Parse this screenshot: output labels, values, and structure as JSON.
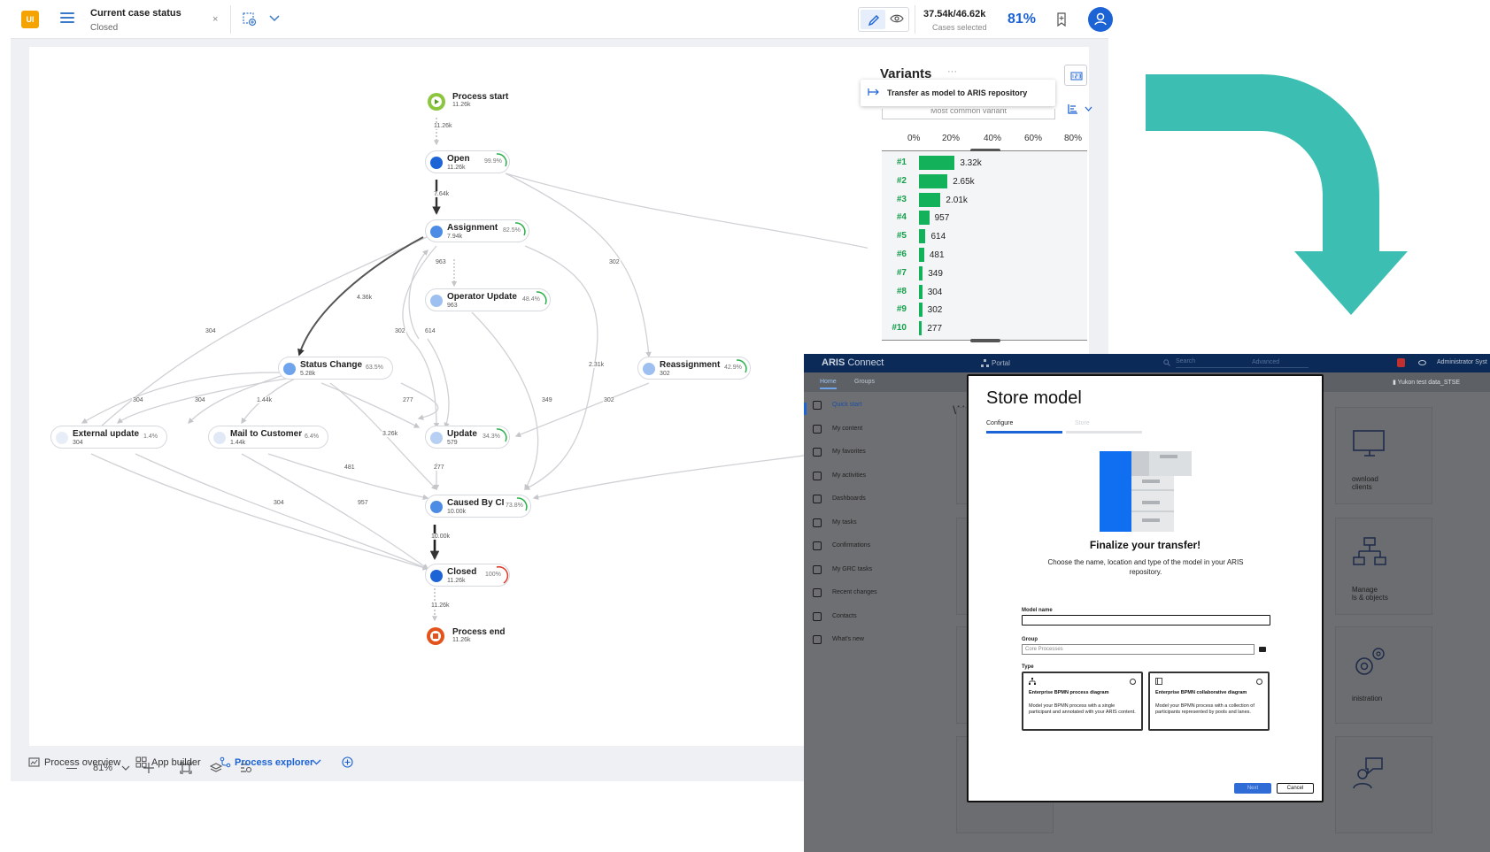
{
  "topbar": {
    "logo": "UI",
    "filter_title": "Current case status",
    "filter_value": "Closed",
    "filter_close": "×",
    "cases_count": "37.54k/46.62k",
    "cases_label": "Cases selected",
    "cases_pct": "81%"
  },
  "graph": {
    "start": {
      "label": "Process start",
      "count": "11.26k"
    },
    "end": {
      "label": "Process end",
      "count": "11.26k"
    },
    "nodes": {
      "open": {
        "label": "Open",
        "count": "11.26k",
        "pct": "99.9%"
      },
      "assignment": {
        "label": "Assignment",
        "count": "7.94k",
        "pct": "82.5%"
      },
      "operator_update": {
        "label": "Operator Update",
        "count": "963",
        "pct": "48.4%"
      },
      "status_change": {
        "label": "Status Change",
        "count": "5.28k",
        "pct": "63.5%"
      },
      "reassignment": {
        "label": "Reassignment",
        "count": "302",
        "pct": "42.9%"
      },
      "external_update": {
        "label": "External update",
        "count": "304",
        "pct": "1.4%"
      },
      "mail_to_customer": {
        "label": "Mail to Customer",
        "count": "1.44k",
        "pct": "6.4%"
      },
      "update": {
        "label": "Update",
        "count": "579",
        "pct": "34.3%"
      },
      "caused_by_ci": {
        "label": "Caused By CI",
        "count": "10.00k",
        "pct": "73.8%"
      },
      "closed": {
        "label": "Closed",
        "count": "11.26k",
        "pct": "100%"
      }
    },
    "edge_labels": {
      "e1": "11.26k",
      "e2": "7.64k",
      "e3": "963",
      "e4": "4.36k",
      "e5": "302",
      "e6": "614",
      "e7": "302",
      "e8": "2.31k",
      "e9": "304",
      "e10": "304",
      "e11": "304",
      "e12": "1.44k",
      "e13": "277",
      "e14": "3.26k",
      "e15": "349",
      "e16": "302",
      "e17": "277",
      "e18": "481",
      "e19": "304",
      "e20": "957",
      "e21": "10.00k",
      "e22": "11.26k"
    }
  },
  "zoom": {
    "level": "81%"
  },
  "variants": {
    "title": "Variants",
    "more": "···",
    "tooltip": "Transfer as model to ARIS repository",
    "select_value": "Most common variant",
    "axis_ticks": [
      "0%",
      "20%",
      "40%",
      "60%",
      "80%"
    ],
    "rows": [
      {
        "rank": "#1",
        "value": "3.32k",
        "count": 3320
      },
      {
        "rank": "#2",
        "value": "2.65k",
        "count": 2650
      },
      {
        "rank": "#3",
        "value": "2.01k",
        "count": 2010
      },
      {
        "rank": "#4",
        "value": "957",
        "count": 957
      },
      {
        "rank": "#5",
        "value": "614",
        "count": 614
      },
      {
        "rank": "#6",
        "value": "481",
        "count": 481
      },
      {
        "rank": "#7",
        "value": "349",
        "count": 349
      },
      {
        "rank": "#8",
        "value": "304",
        "count": 304
      },
      {
        "rank": "#9",
        "value": "302",
        "count": 302
      },
      {
        "rank": "#10",
        "value": "277",
        "count": 277
      }
    ]
  },
  "bottom_tabs": {
    "overview": "Process overview",
    "builder": "App builder",
    "explorer": "Process explorer"
  },
  "arrow_color": "#3cbfb2",
  "aris": {
    "brand": "ARIS",
    "brand_suffix": "Connect",
    "portal": "Portal",
    "search": "Search",
    "advanced": "Advanced",
    "admin": "Administrator Syst",
    "tabs": {
      "home": "Home",
      "groups": "Groups"
    },
    "database": "Yukon test data_STSE",
    "welcome": "We",
    "sidebar": [
      "Quick start",
      "My content",
      "My favorites",
      "My activities",
      "Dashboards",
      "My tasks",
      "Confirmations",
      "My GRC tasks",
      "Recent changes",
      "Contacts",
      "What's new"
    ],
    "tiles": {
      "download_line1": "ownload",
      "download_line2": "clients",
      "manage_line1": "Manage",
      "manage_line2": "ls & objects",
      "administration": "inistration"
    },
    "dialog": {
      "title": "Store model",
      "step1": "Configure",
      "step2": "Store",
      "heading": "Finalize your transfer!",
      "description": "Choose the name, location and type of the model in your ARIS repository.",
      "model_name_label": "Model name",
      "group_label": "Group",
      "group_value": "Core Processes",
      "type_label": "Type",
      "card1_title": "Enterprise BPMN process diagram",
      "card1_text": "Model your BPMN process with a single participant and annotated with your ARIS content.",
      "card2_title": "Enterprise BPMN collaborative diagram",
      "card2_text": "Model your BPMN process with a collection of participants represented by pools and lanes.",
      "next": "Next",
      "cancel": "Cancel"
    }
  }
}
